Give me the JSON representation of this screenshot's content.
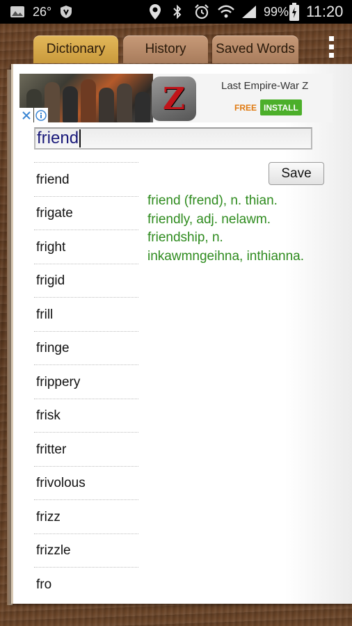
{
  "status_bar": {
    "temperature": "26°",
    "battery_percent": "99%",
    "time": "11:20",
    "icons": [
      "gallery-icon",
      "shield-icon",
      "location-icon",
      "bluetooth-icon",
      "alarm-icon",
      "wifi-icon",
      "signal-icon",
      "battery-charging-icon"
    ]
  },
  "tabs": [
    {
      "label": "Dictionary",
      "active": true
    },
    {
      "label": "History",
      "active": false
    },
    {
      "label": "Saved Words",
      "active": false
    }
  ],
  "ad": {
    "title": "Last Empire-War Z",
    "free_label": "FREE",
    "install_label": "INSTALL",
    "icon_letter": "Z"
  },
  "search": {
    "value": "friend"
  },
  "save_label": "Save",
  "words": [
    "friend",
    "frigate",
    "fright",
    "frigid",
    "frill",
    "fringe",
    "frippery",
    "frisk",
    "fritter",
    "frivolous",
    "frizz",
    "frizzle",
    "fro"
  ],
  "definition_lines": [
    "friend (frend), n. thian.",
    "friendly, adj. nelawm.",
    "friendship, n.",
    "inkawmngeihna, inthianna."
  ],
  "colors": {
    "definition_text": "#2e8b1e",
    "active_tab": "#d9ab4c",
    "inactive_tab": "#b68a6a",
    "install_button": "#4caf2a"
  }
}
